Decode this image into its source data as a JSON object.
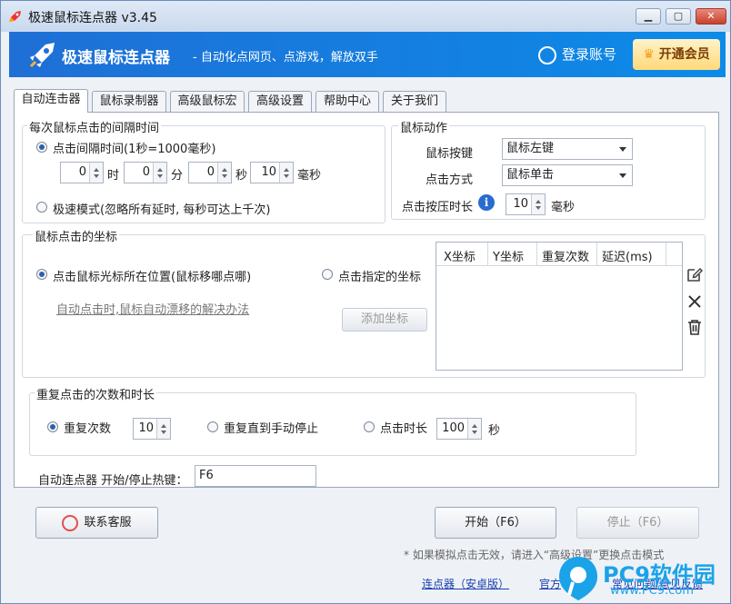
{
  "window": {
    "title": "极速鼠标连点器 v3.45",
    "min": "▭",
    "max": "▢",
    "close": "✕"
  },
  "banner": {
    "brand": "极速鼠标连点器",
    "slogan": "- 自动化点网页、点游戏，解放双手",
    "login": "登录账号",
    "vip": "开通会员"
  },
  "tabs": [
    "自动连击器",
    "鼠标录制器",
    "高级鼠标宏",
    "高级设置",
    "帮助中心",
    "关于我们"
  ],
  "interval": {
    "legend": "每次鼠标点击的间隔时间",
    "radio1": "点击间隔时间(1秒=1000毫秒)",
    "hour": "0",
    "hour_u": "时",
    "min": "0",
    "min_u": "分",
    "sec": "0",
    "sec_u": "秒",
    "ms": "10",
    "ms_u": "毫秒",
    "radio2": "极速模式(忽略所有延时, 每秒可达上千次)"
  },
  "action": {
    "legend": "鼠标动作",
    "button_label": "鼠标按键",
    "button_value": "鼠标左键",
    "mode_label": "点击方式",
    "mode_value": "鼠标单击",
    "press_label": "点击按压时长",
    "press_value": "10",
    "press_unit": "毫秒",
    "info": "i"
  },
  "coords": {
    "legend": "鼠标点击的坐标",
    "radio_cursor": "点击鼠标光标所在位置(鼠标移哪点哪)",
    "radio_fixed": "点击指定的坐标",
    "fix_link": "自动点击时,鼠标自动漂移的解决办法",
    "add_btn": "添加坐标",
    "columns": [
      "X坐标",
      "Y坐标",
      "重复次数",
      "延迟(ms)"
    ]
  },
  "repeat": {
    "legend": "重复点击的次数和时长",
    "r1": "重复次数",
    "r1_value": "10",
    "r2": "重复直到手动停止",
    "r3": "点击时长",
    "r3_value": "100",
    "r3_unit": "秒"
  },
  "hotkey": {
    "label": "自动连点器 开始/停止热键：",
    "value": "F6"
  },
  "buttons": {
    "service": "联系客服",
    "start": "开始（F6）",
    "stop": "停止（F6）"
  },
  "note": "* 如果模拟点击无效，请进入“高级设置”更换点击模式",
  "links": {
    "android": "连点器（安卓版）",
    "official": "官方",
    "faq": "常见问题/意见反馈"
  },
  "watermark": {
    "name": "PC9软件园",
    "url": "www.PC9.com"
  }
}
